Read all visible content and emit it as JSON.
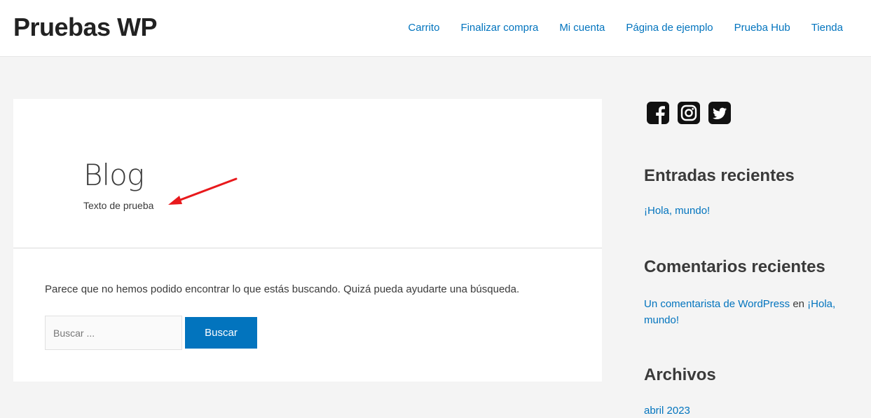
{
  "header": {
    "site_title": "Pruebas WP",
    "nav": [
      "Carrito",
      "Finalizar compra",
      "Mi cuenta",
      "Página de ejemplo",
      "Prueba Hub",
      "Tienda"
    ]
  },
  "main": {
    "title": "Blog",
    "description": "Texto de prueba",
    "not_found_text": "Parece que no hemos podido encontrar lo que estás buscando. Quizá pueda ayudarte una búsqueda.",
    "search_placeholder": "Buscar ...",
    "search_button": "Buscar",
    "annotation_arrow_color": "#e8191c"
  },
  "sidebar": {
    "social_icons": [
      "facebook-icon",
      "instagram-icon",
      "twitter-icon"
    ],
    "recent_posts_title": "Entradas recientes",
    "recent_posts": [
      "¡Hola, mundo!"
    ],
    "recent_comments_title": "Comentarios recientes",
    "recent_comment": {
      "author": "Un comentarista de WordPress",
      "connector": "en",
      "post": "¡Hola, mundo!"
    },
    "archives_title": "Archivos",
    "archives": [
      "abril 2023"
    ]
  },
  "colors": {
    "accent": "#0274be",
    "background": "#f4f4f4"
  }
}
